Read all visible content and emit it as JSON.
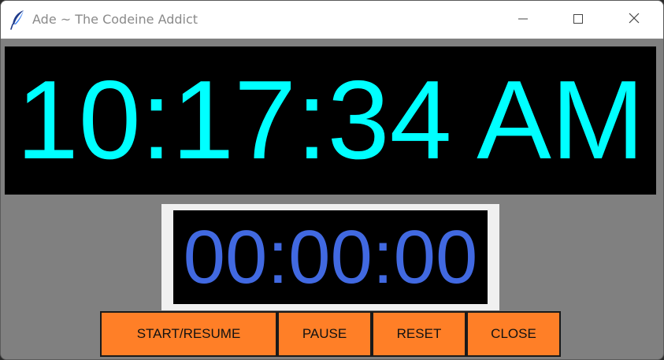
{
  "window": {
    "title": "Ade ~ The Codeine Addict",
    "app_icon": "feather-icon",
    "controls": {
      "minimize_icon": "minimize-icon",
      "maximize_icon": "maximize-icon",
      "close_icon": "close-icon"
    }
  },
  "clock": {
    "time": "10:17:34 AM",
    "color": "#00ffff",
    "background": "#000000"
  },
  "stopwatch": {
    "elapsed": "00:00:00",
    "color": "#4169e1",
    "background": "#000000"
  },
  "buttons": {
    "start_label": "START/RESUME",
    "pause_label": "PAUSE",
    "reset_label": "RESET",
    "close_label": "CLOSE",
    "color": "#ff7f27"
  },
  "theme": {
    "window_background": "#808080"
  }
}
